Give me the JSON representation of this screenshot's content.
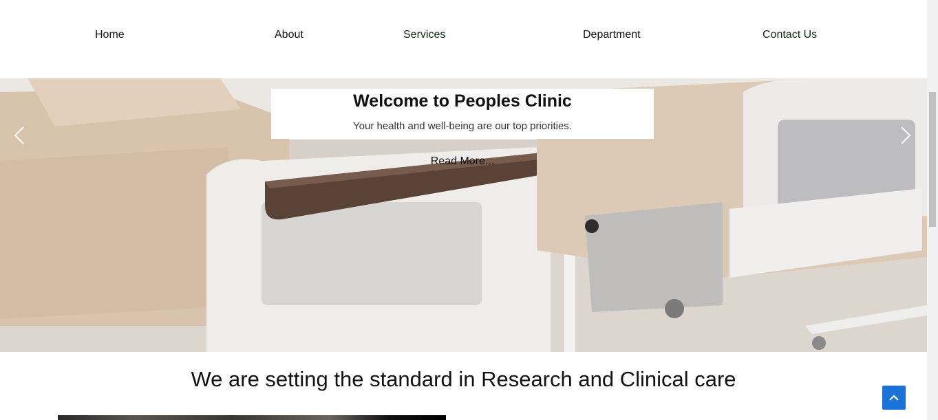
{
  "nav": {
    "items": [
      {
        "label": "Home"
      },
      {
        "label": "About"
      },
      {
        "label": "Services"
      },
      {
        "label": "Department"
      },
      {
        "label": "Contact Us"
      }
    ]
  },
  "hero": {
    "title": "Welcome to Peoples Clinic",
    "subtitle": "Your health and well-being are our top priorities.",
    "read_more": "Read More..."
  },
  "icons": {
    "prev": "chevron-left-icon",
    "next": "chevron-right-icon",
    "back_to_top": "chevron-up-icon"
  },
  "section": {
    "heading": "We are setting the standard in Research and Clinical care"
  },
  "colors": {
    "accent": "#1a73d9",
    "nav_text": "#111111",
    "caption_bg": "#ffffff"
  }
}
